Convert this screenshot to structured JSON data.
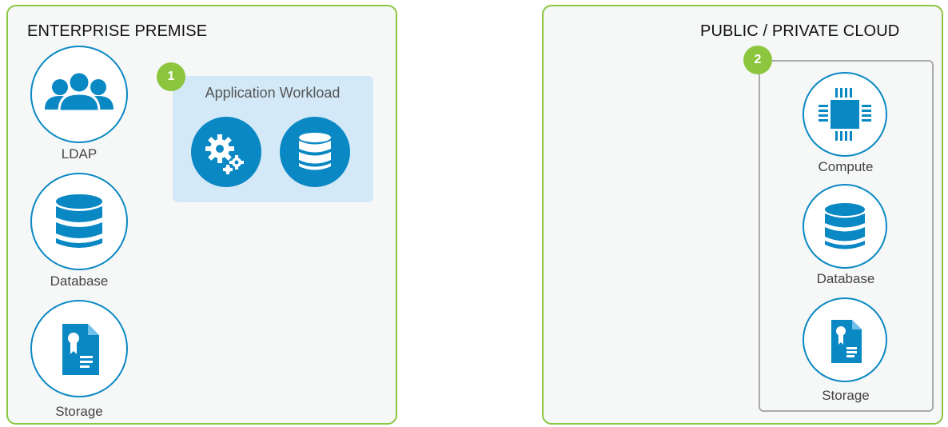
{
  "colors": {
    "accent_green": "#8cc63f",
    "accent_blue": "#0a88c4",
    "app_box_bg": "#d3e9f8",
    "panel_bg": "#f6f7f7"
  },
  "enterprise": {
    "title": "ENTERPRISE PREMISE",
    "items": [
      {
        "label": "LDAP",
        "icon": "users-icon"
      },
      {
        "label": "Database",
        "icon": "database-icon"
      },
      {
        "label": "Storage",
        "icon": "certificate-document-icon"
      }
    ],
    "workload": {
      "badge": "1",
      "title": "Application Workload",
      "icons": [
        "gears-icon",
        "database-icon"
      ]
    }
  },
  "cloud": {
    "title": "PUBLIC / PRIVATE CLOUD",
    "badge": "2",
    "items": [
      {
        "label": "Compute",
        "icon": "cpu-chip-icon"
      },
      {
        "label": "Database",
        "icon": "database-icon"
      },
      {
        "label": "Storage",
        "icon": "certificate-document-icon"
      }
    ]
  }
}
